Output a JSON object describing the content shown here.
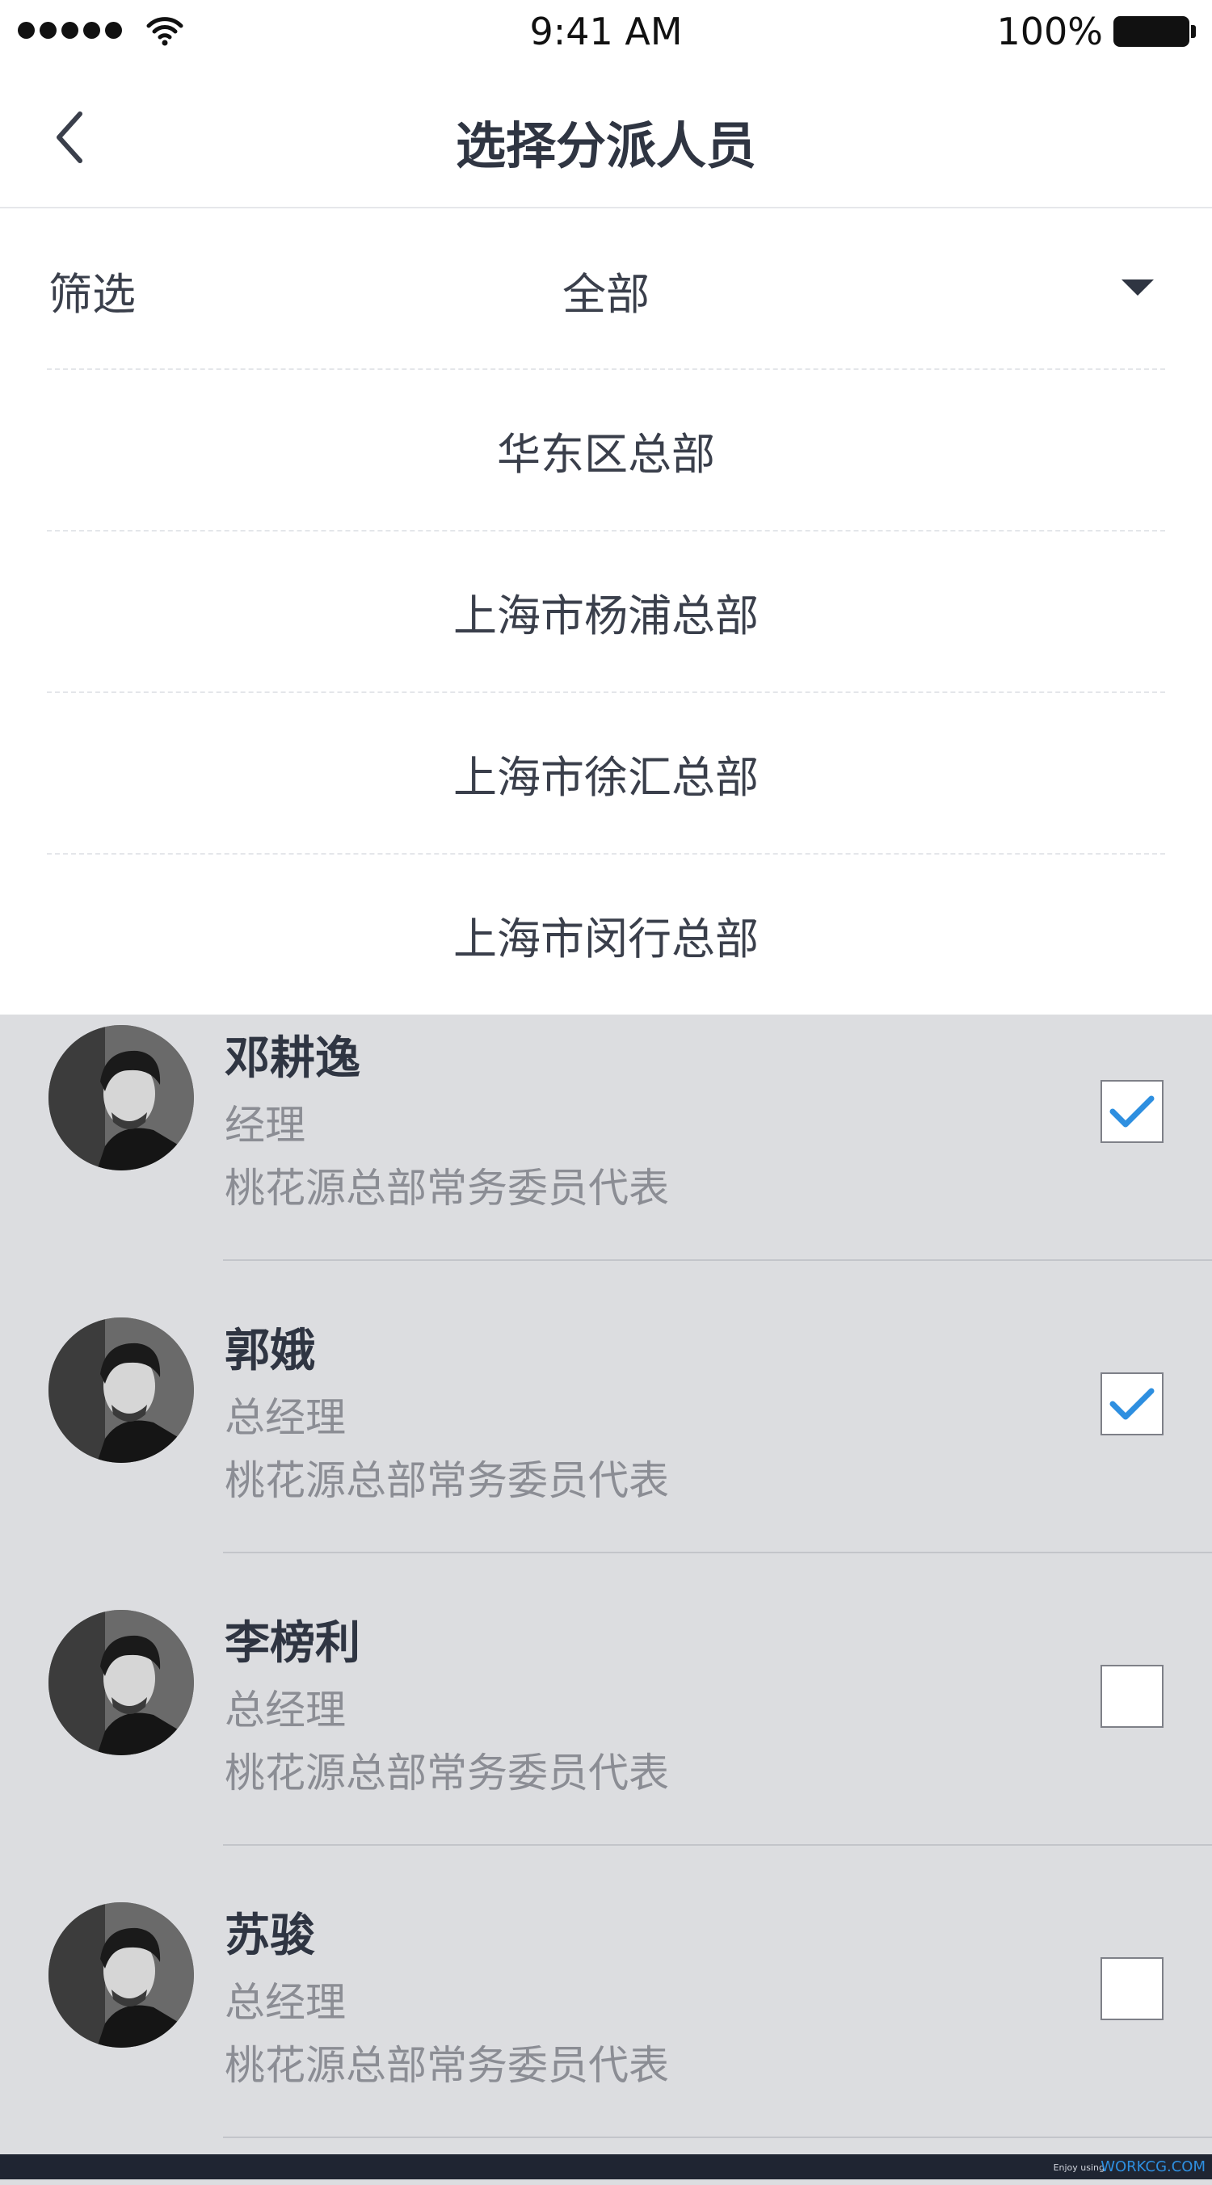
{
  "status_bar": {
    "time": "9:41 AM",
    "battery": "100%"
  },
  "nav": {
    "title": "选择分派人员"
  },
  "filter": {
    "label": "筛选",
    "selected": "全部",
    "options": [
      "华东区总部",
      "上海市杨浦总部",
      "上海市徐汇总部",
      "上海市闵行总部"
    ]
  },
  "people": [
    {
      "name": "邓耕逸",
      "role": "经理",
      "desc": "桃花源总部常务委员代表",
      "checked": true
    },
    {
      "name": "郭娥",
      "role": "总经理",
      "desc": "桃花源总部常务委员代表",
      "checked": true
    },
    {
      "name": "李榜利",
      "role": "总经理",
      "desc": "桃花源总部常务委员代表",
      "checked": false
    },
    {
      "name": "苏骏",
      "role": "总经理",
      "desc": "桃花源总部常务委员代表",
      "checked": false
    }
  ],
  "footer": {
    "small": "Enjoy using",
    "brand": "WORKCG.COM"
  },
  "colors": {
    "accent": "#2e8fe0",
    "text": "#2f3542",
    "muted": "#8b8d94",
    "overlay": "#dcdde0"
  }
}
